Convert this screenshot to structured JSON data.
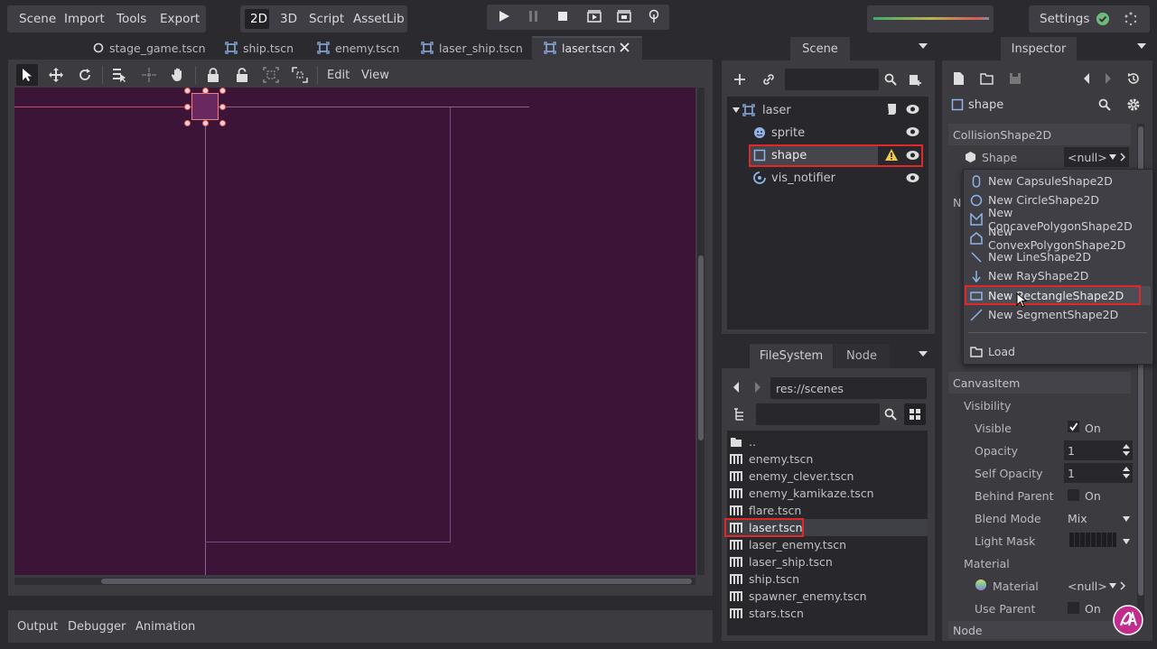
{
  "menu": {
    "scene": "Scene",
    "import": "Import",
    "tools": "Tools",
    "export": "Export"
  },
  "workspaces": {
    "2d": "2D",
    "3d": "3D",
    "script": "Script",
    "assetlib": "AssetLib"
  },
  "settings": {
    "label": "Settings"
  },
  "tabs": [
    {
      "label": "stage_game.tscn"
    },
    {
      "label": "ship.tscn"
    },
    {
      "label": "enemy.tscn"
    },
    {
      "label": "laser_ship.tscn"
    },
    {
      "label": "laser.tscn"
    }
  ],
  "viewport_toolbar": {
    "edit": "Edit",
    "view": "View"
  },
  "bottom_panel": {
    "output": "Output",
    "debugger": "Debugger",
    "animation": "Animation"
  },
  "scene_dock": {
    "title": "Scene",
    "tree": [
      {
        "label": "laser",
        "icon": "node2d-icon"
      },
      {
        "label": "sprite",
        "icon": "sprite-icon"
      },
      {
        "label": "shape",
        "icon": "collision-shape-icon"
      },
      {
        "label": "vis_notifier",
        "icon": "visibility-notifier-icon"
      }
    ]
  },
  "filesystem_dock": {
    "tab_filesystem": "FileSystem",
    "tab_node": "Node",
    "path": "res://scenes",
    "files": [
      "..",
      "enemy.tscn",
      "enemy_clever.tscn",
      "enemy_kamikaze.tscn",
      "flare.tscn",
      "laser.tscn",
      "laser_enemy.tscn",
      "laser_ship.tscn",
      "ship.tscn",
      "spawner_enemy.tscn",
      "stars.tscn"
    ]
  },
  "inspector": {
    "title": "Inspector",
    "node_name": "shape",
    "section_collision": "CollisionShape2D",
    "shape_label": "Shape",
    "shape_value": "<null>",
    "partial_label": "N",
    "section_canvas": "CanvasItem",
    "visibility": "Visibility",
    "visible_label": "Visible",
    "visible_value": "On",
    "opacity_label": "Opacity",
    "opacity_value": "1",
    "self_opacity_label": "Self Opacity",
    "self_opacity_value": "1",
    "behind_parent_label": "Behind Parent",
    "behind_parent_value": "On",
    "blend_mode_label": "Blend Mode",
    "blend_mode_value": "Mix",
    "light_mask_label": "Light Mask",
    "material_group": "Material",
    "material_label": "Material",
    "material_value": "<null>",
    "use_parent_label": "Use Parent",
    "use_parent_value": "On",
    "section_node": "Node"
  },
  "shape_dropdown": {
    "items": [
      {
        "label": "New CapsuleShape2D",
        "icon": "capsule-icon"
      },
      {
        "label": "New CircleShape2D",
        "icon": "circle-icon"
      },
      {
        "label": "New ConcavePolygonShape2D",
        "icon": "concave-polygon-icon"
      },
      {
        "label": "New ConvexPolygonShape2D",
        "icon": "convex-polygon-icon"
      },
      {
        "label": "New LineShape2D",
        "icon": "line-icon"
      },
      {
        "label": "New RayShape2D",
        "icon": "ray-icon"
      },
      {
        "label": "New RectangleShape2D",
        "icon": "rectangle-icon"
      },
      {
        "label": "New SegmentShape2D",
        "icon": "segment-icon"
      }
    ],
    "load": "Load"
  },
  "colors": {
    "viewport_bg": "#3c1438",
    "highlight_red": "#e0282a",
    "accent_blue": "#8fb4e8"
  }
}
